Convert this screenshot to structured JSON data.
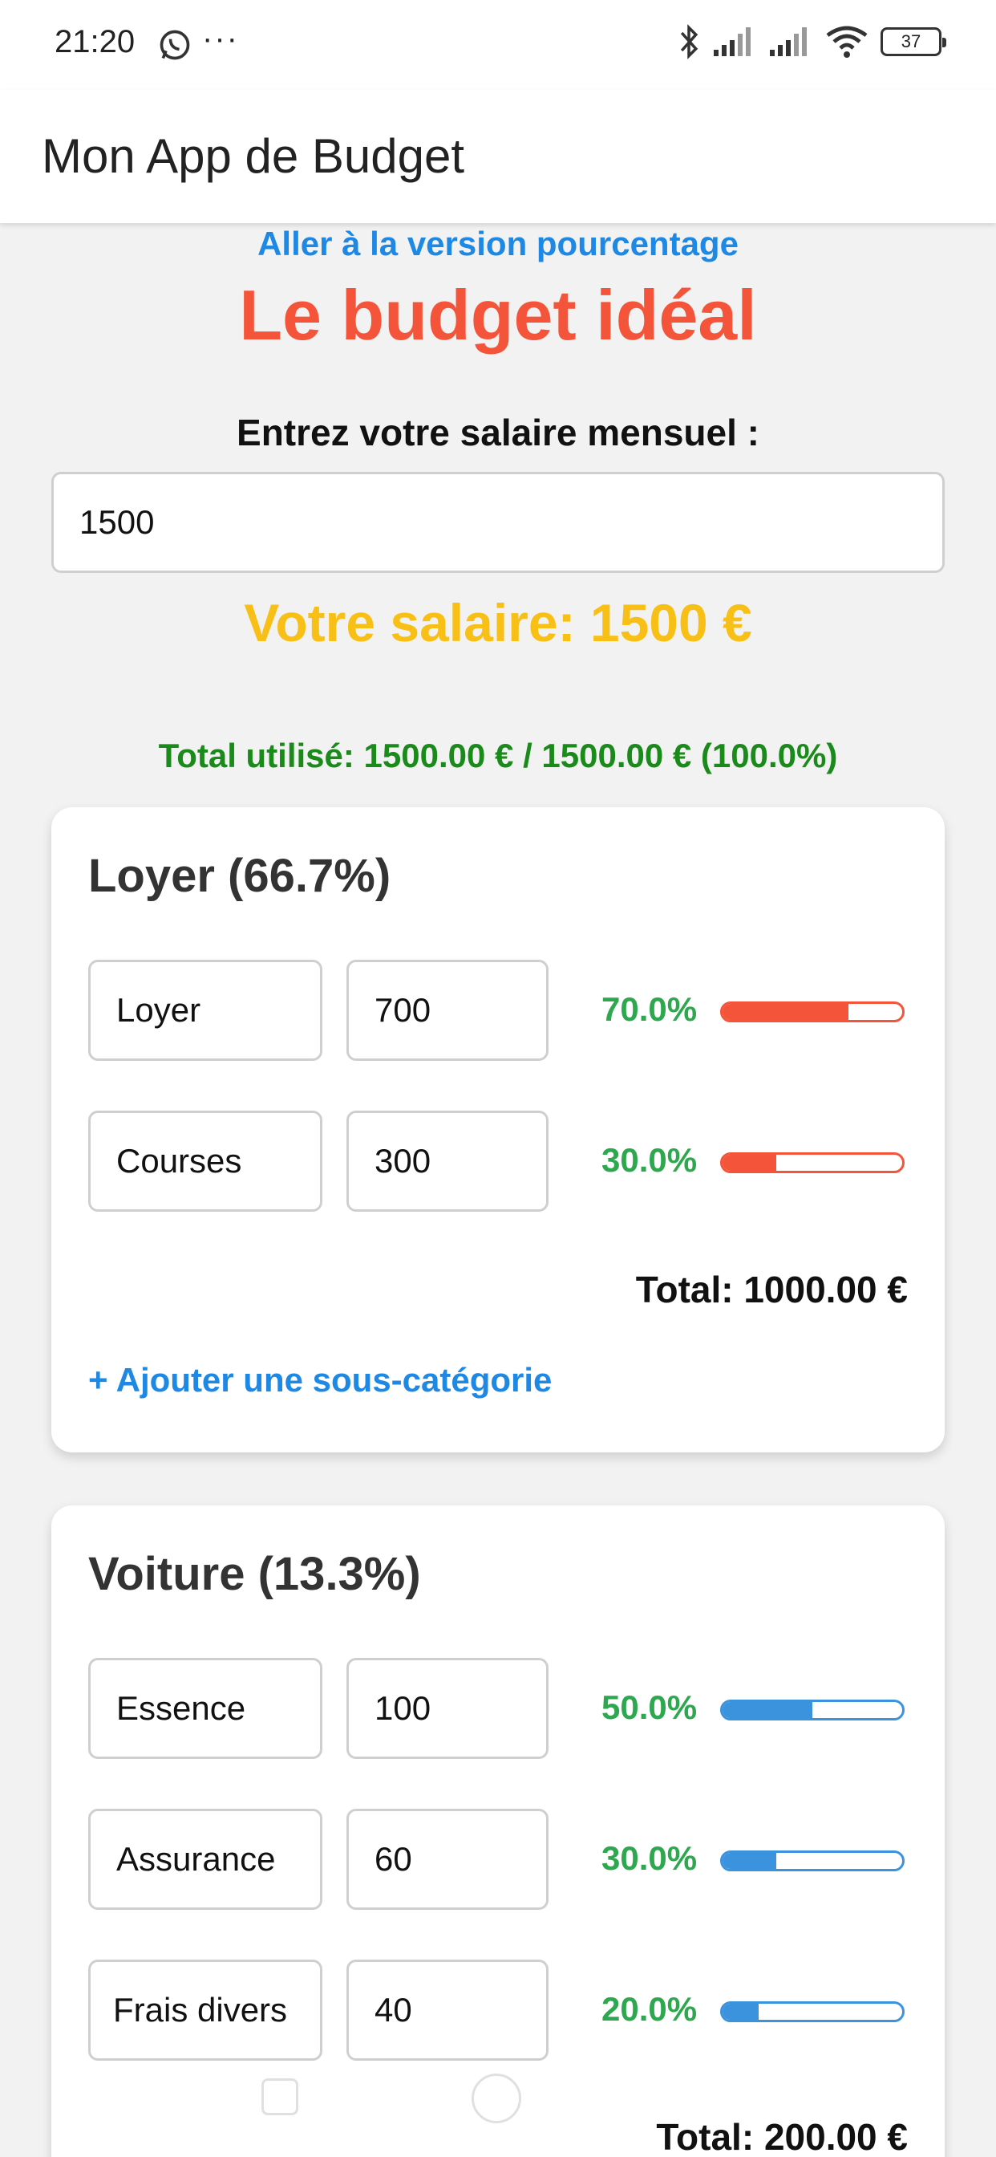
{
  "status_bar": {
    "time": "21:20",
    "dots": "···",
    "battery": "37",
    "icons": [
      "whatsapp-icon",
      "bluetooth-icon",
      "signal-icon",
      "signal-icon",
      "wifi-icon",
      "battery-icon"
    ]
  },
  "app_bar": {
    "title": "Mon App de Budget"
  },
  "main": {
    "percentage_link": "Aller à la version pourcentage",
    "title": "Le budget idéal",
    "salary_label": "Entrez votre salaire mensuel :",
    "salary_value": "1500",
    "salary_display": "Votre salaire: 1500 €",
    "total_used": "Total utilisé: 1500.00 € / 1500.00 € (100.0%)"
  },
  "colors": {
    "accent_blue": "#1e88e5",
    "title_red": "#f4553a",
    "salary_yellow": "#f8c016",
    "percent_green": "#2ea84f",
    "total_green": "#1a8a1a",
    "bar_blue": "#3a93dc"
  },
  "categories": [
    {
      "title": "Loyer (66.7%)",
      "total": "Total: 1000.00 €",
      "add_label": "+ Ajouter une sous-catégorie",
      "items": [
        {
          "name": "Loyer",
          "amount": "700",
          "percent": "70.0%",
          "fill": 0.7
        },
        {
          "name": "Courses",
          "amount": "300",
          "percent": "30.0%",
          "fill": 0.3
        }
      ]
    },
    {
      "title": "Voiture (13.3%)",
      "total": "Total: 200.00 €",
      "items": [
        {
          "name": "Essence",
          "amount": "100",
          "percent": "50.0%",
          "fill": 0.5
        },
        {
          "name": "Assurance",
          "amount": "60",
          "percent": "30.0%",
          "fill": 0.3
        },
        {
          "name": "Frais divers",
          "amount": "40",
          "percent": "20.0%",
          "fill": 0.2
        }
      ]
    }
  ]
}
